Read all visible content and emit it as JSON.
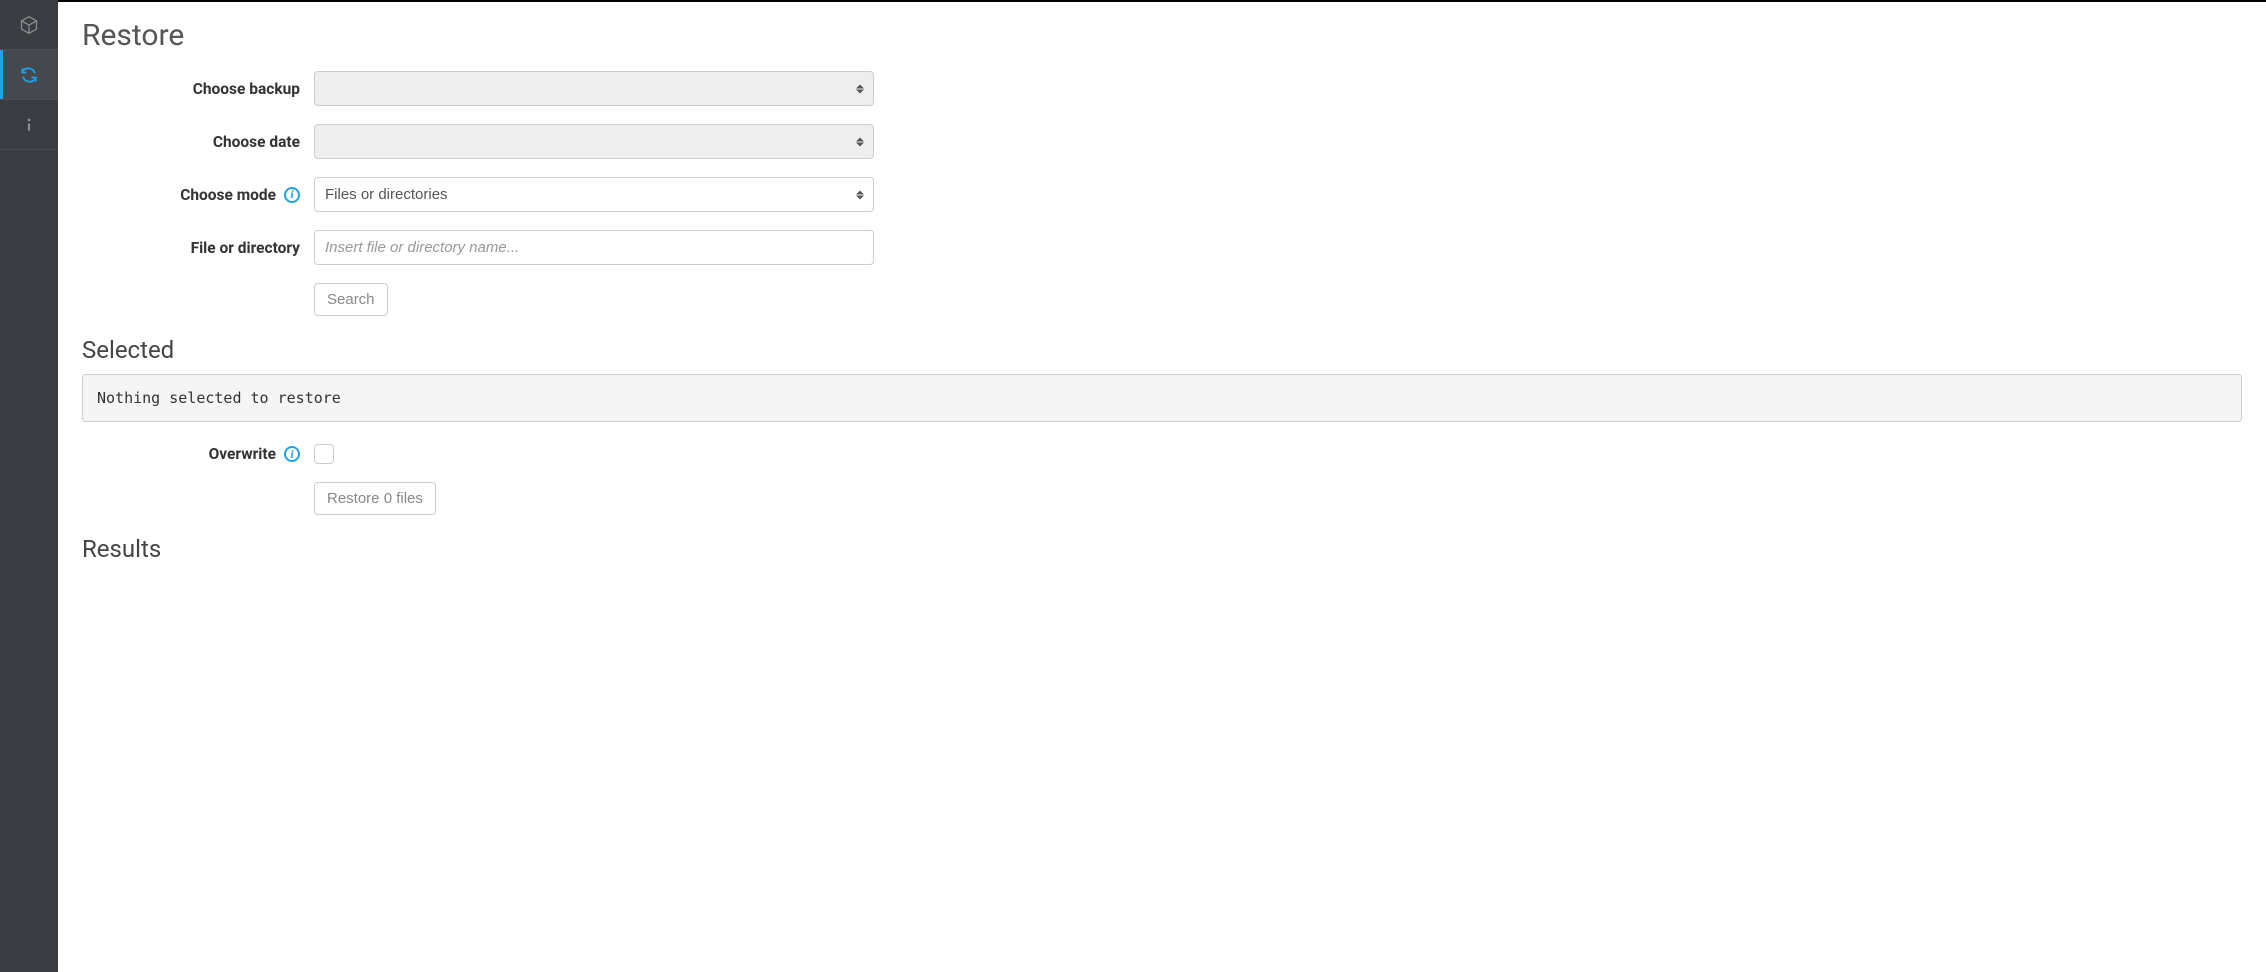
{
  "page": {
    "title": "Restore",
    "selected_heading": "Selected",
    "results_heading": "Results"
  },
  "labels": {
    "choose_backup": "Choose backup",
    "choose_date": "Choose date",
    "choose_mode": "Choose mode",
    "file_or_dir": "File or directory",
    "overwrite": "Overwrite"
  },
  "fields": {
    "backup_selected": "",
    "date_selected": "",
    "mode_selected": "Files or directories",
    "file_value": "",
    "file_placeholder": "Insert file or directory name...",
    "overwrite_checked": false
  },
  "buttons": {
    "search": "Search",
    "restore": "Restore 0 files"
  },
  "selected_message": "Nothing selected to restore",
  "sidebar": {
    "items": [
      {
        "name": "backup",
        "active": false
      },
      {
        "name": "restore",
        "active": true
      },
      {
        "name": "info",
        "active": false
      }
    ]
  },
  "colors": {
    "accent": "#1ca3ec"
  }
}
